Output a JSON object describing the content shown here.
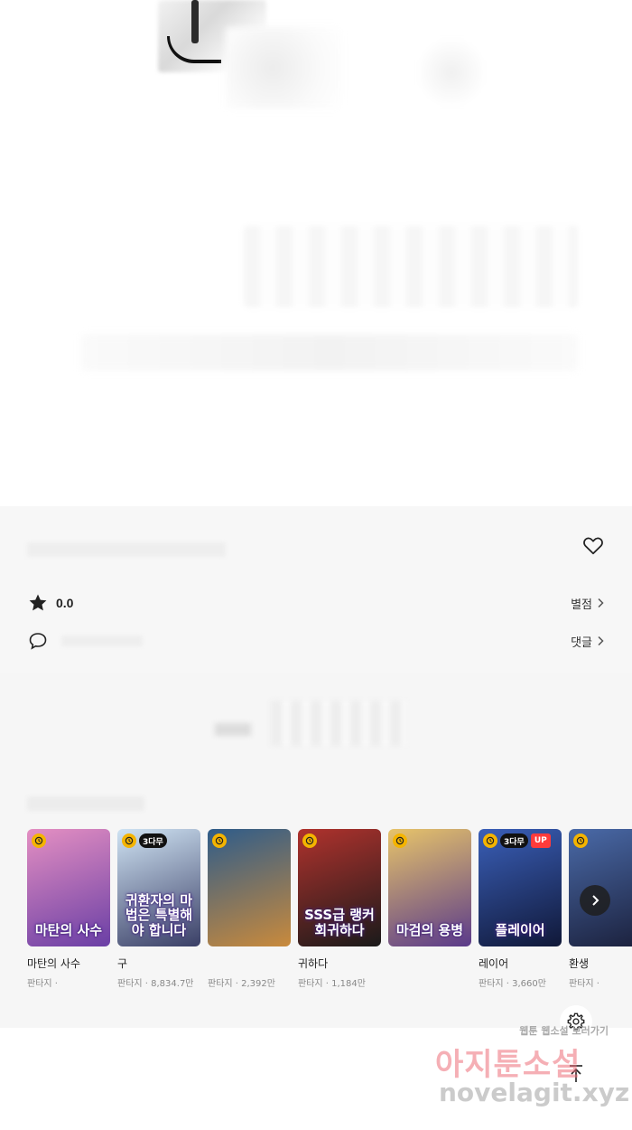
{
  "info": {
    "rating_value": "0.0",
    "rating_link": "별점",
    "comment_link": "댓글"
  },
  "recommendations": {
    "items": [
      {
        "title": "마탄의 사수",
        "meta": "판타지 ·",
        "cover_text": "마탄의 사수",
        "badge_label": "",
        "badge_up": "",
        "cover_colors": [
          "#e48fc2",
          "#6a3fa5"
        ]
      },
      {
        "title": "구",
        "meta": "판타지 · 8,834.7만",
        "cover_text": "귀환자의 마법은 특별해야 합니다",
        "badge_label": "3다무",
        "badge_up": "",
        "cover_colors": [
          "#cfe3f3",
          "#3a3f66"
        ]
      },
      {
        "title": "",
        "meta": "판타지 · 2,392만",
        "cover_text": "",
        "badge_label": "",
        "badge_up": "",
        "cover_colors": [
          "#2e5c8a",
          "#c98a3c"
        ]
      },
      {
        "title": "귀하다",
        "meta": "판타지 · 1,184만",
        "cover_text": "SSS급 랭커 회귀하다",
        "badge_label": "",
        "badge_up": "",
        "cover_colors": [
          "#b0322d",
          "#1a1a1a"
        ]
      },
      {
        "title": "",
        "meta": "",
        "cover_text": "마검의 용병",
        "badge_label": "",
        "badge_up": "",
        "cover_colors": [
          "#e7c46a",
          "#5a3a8a"
        ]
      },
      {
        "title": "레이어",
        "meta": "판타지 · 3,660만",
        "cover_text": "플레이어",
        "badge_label": "3다무",
        "badge_up": "UP",
        "cover_colors": [
          "#3a5fb8",
          "#101838"
        ]
      },
      {
        "title": "환생",
        "meta": "판타지 ·",
        "cover_text": "",
        "badge_label": "",
        "badge_up": "",
        "cover_colors": [
          "#4a6aa8",
          "#1a1f3a"
        ]
      }
    ]
  },
  "watermark": {
    "small": "웹툰 웹소설 보러가기",
    "big": "아지툰소설",
    "url": "novelagit.xyz"
  }
}
